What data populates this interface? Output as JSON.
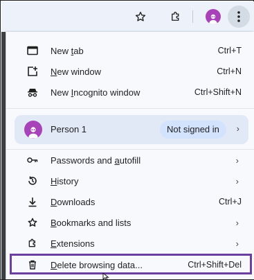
{
  "toolbar": {
    "bookmark_icon": "star-outline-icon",
    "extensions_icon": "puzzle-icon",
    "profile_icon": "incognito-avatar-icon",
    "menu_icon": "vertical-dots-icon"
  },
  "menu": {
    "new_tab": {
      "pre": "New ",
      "key": "t",
      "post": "ab",
      "shortcut": "Ctrl+T",
      "icon": "new-tab-icon"
    },
    "new_window": {
      "pre": "",
      "key": "N",
      "post": "ew window",
      "shortcut": "Ctrl+N",
      "icon": "new-window-icon"
    },
    "new_incognito": {
      "pre": "New ",
      "key": "I",
      "post": "ncognito window",
      "shortcut": "Ctrl+Shift+N",
      "icon": "incognito-icon"
    },
    "profile": {
      "name": "Person 1",
      "status": "Not signed in",
      "icon": "avatar-icon"
    },
    "passwords": {
      "pre": "Passwords and ",
      "key": "a",
      "post": "utofill",
      "icon": "key-icon"
    },
    "history": {
      "pre": "",
      "key": "H",
      "post": "istory",
      "icon": "history-icon"
    },
    "downloads": {
      "pre": "",
      "key": "D",
      "post": "ownloads",
      "shortcut": "Ctrl+J",
      "icon": "download-icon"
    },
    "bookmarks": {
      "pre": "",
      "key": "B",
      "post": "ookmarks and lists",
      "icon": "bookmark-star-icon"
    },
    "extensions": {
      "pre": "",
      "key": "E",
      "post": "xtensions",
      "icon": "puzzle-icon"
    },
    "delete_data": {
      "pre": "",
      "key": "D",
      "post": "elete browsing data...",
      "shortcut": "Ctrl+Shift+Del",
      "icon": "trash-icon"
    }
  },
  "colors": {
    "highlight_border": "#6b3fa0",
    "avatar": "#a742b8",
    "chip": "#d3e3fd"
  }
}
